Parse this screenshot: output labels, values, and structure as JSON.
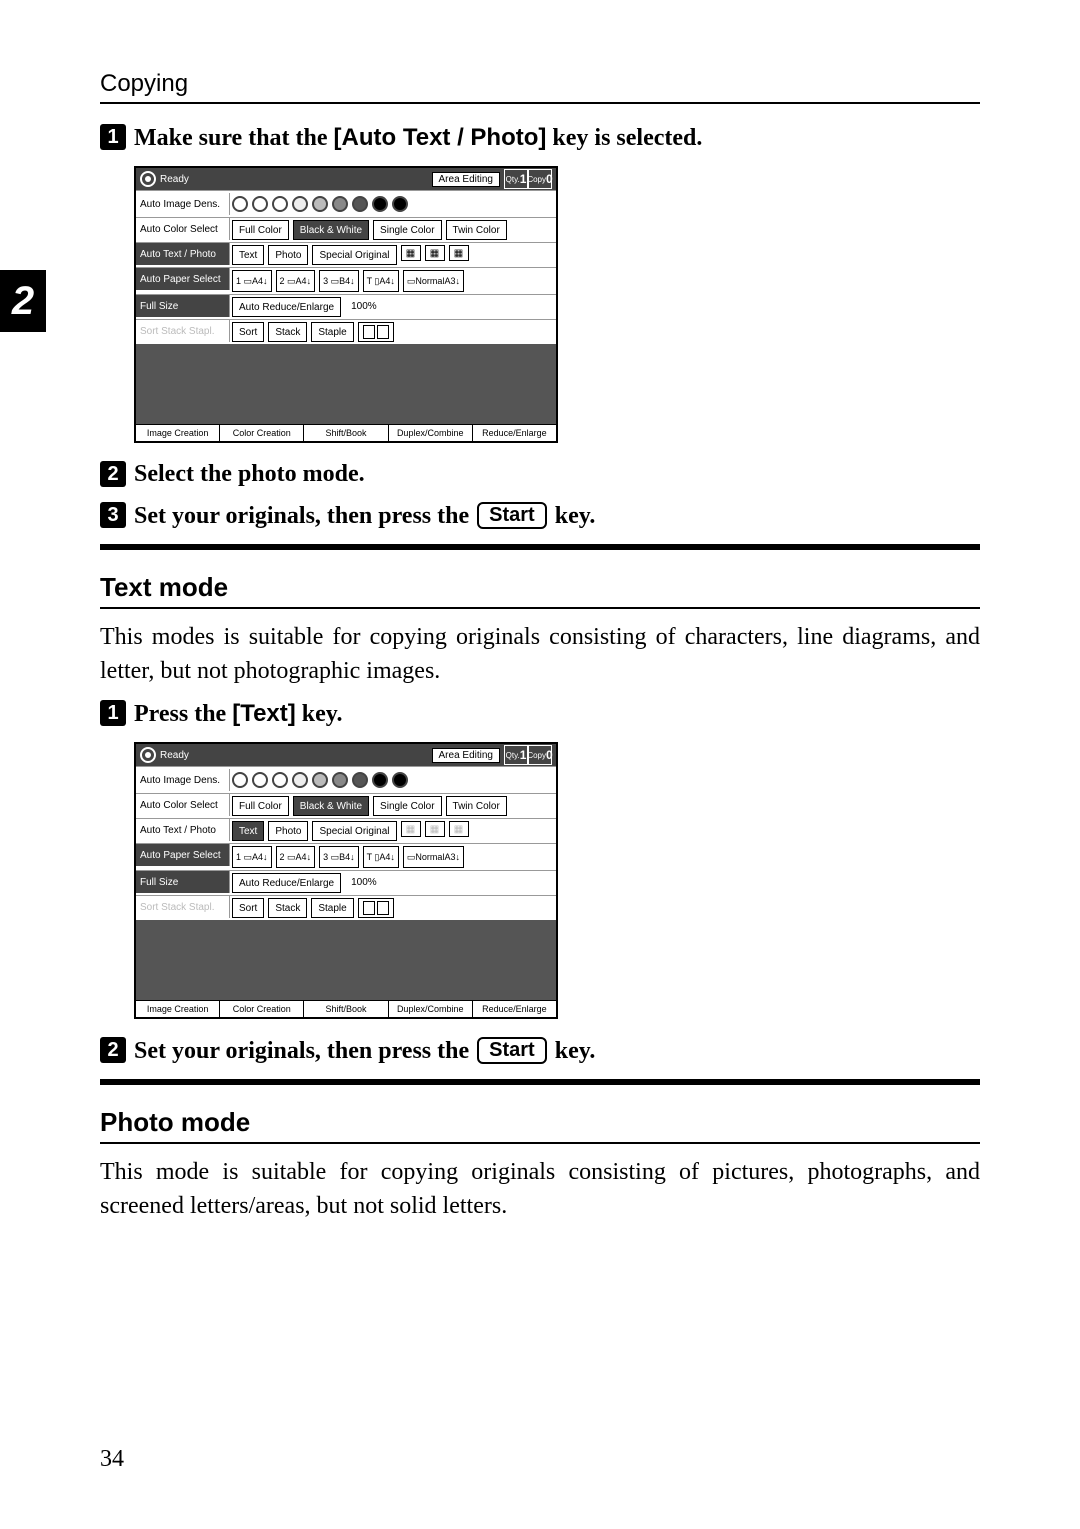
{
  "header": {
    "title": "Copying"
  },
  "side_tab": "2",
  "page_number": "34",
  "steps_a": {
    "s1": {
      "pre": "Make sure that the ",
      "key": "[Auto Text / Photo]",
      "post": " key is selected."
    },
    "s2": "Select the photo mode.",
    "s3": {
      "pre": "Set your originals, then press the ",
      "key": "Start",
      "post": " key."
    }
  },
  "text_mode": {
    "title": "Text mode",
    "body": "This modes is suitable for copying originals consisting of characters, line diagrams, and letter, but not photographic images.",
    "s1": {
      "pre": "Press the ",
      "key": "[Text]",
      "post": " key."
    },
    "s2": {
      "pre": "Set your originals, then press the ",
      "key": "Start",
      "post": " key."
    }
  },
  "photo_mode": {
    "title": "Photo mode",
    "body": "This mode is suitable for copying originals consisting of pictures, photographs, and screened letters/areas, but not solid letters."
  },
  "panel": {
    "ready": "Ready",
    "area_editing": "Area Editing",
    "qty_label": "Qty.",
    "qty_val": "1",
    "copy_label": "Copy",
    "copy_val": "0",
    "rows": {
      "density": "Auto Image Dens.",
      "color_select": "Auto Color Select",
      "text_photo": "Auto Text / Photo",
      "paper_select": "Auto Paper Select",
      "full_size": "Full Size",
      "sort_stack": "Sort Stack Stapl."
    },
    "color_opts": {
      "full": "Full Color",
      "bw": "Black & White",
      "single": "Single Color",
      "twin": "Twin Color"
    },
    "text_opts": {
      "text": "Text",
      "photo": "Photo",
      "special": "Special Original"
    },
    "paper_opts": {
      "t1": "A4",
      "t2": "A4",
      "t3": "B4",
      "t4": "A4",
      "t5": "A3",
      "normal": "Normal"
    },
    "size_opts": {
      "auto_reduce": "Auto Reduce/Enlarge",
      "pct": "100%"
    },
    "sort_opts": {
      "sort": "Sort",
      "stack": "Stack",
      "staple": "Staple"
    },
    "bottom_tabs": {
      "t1": "Image Creation",
      "t2": "Color Creation",
      "t3": "Shift/Book",
      "t4": "Duplex/Combine",
      "t5": "Reduce/Enlarge"
    }
  }
}
